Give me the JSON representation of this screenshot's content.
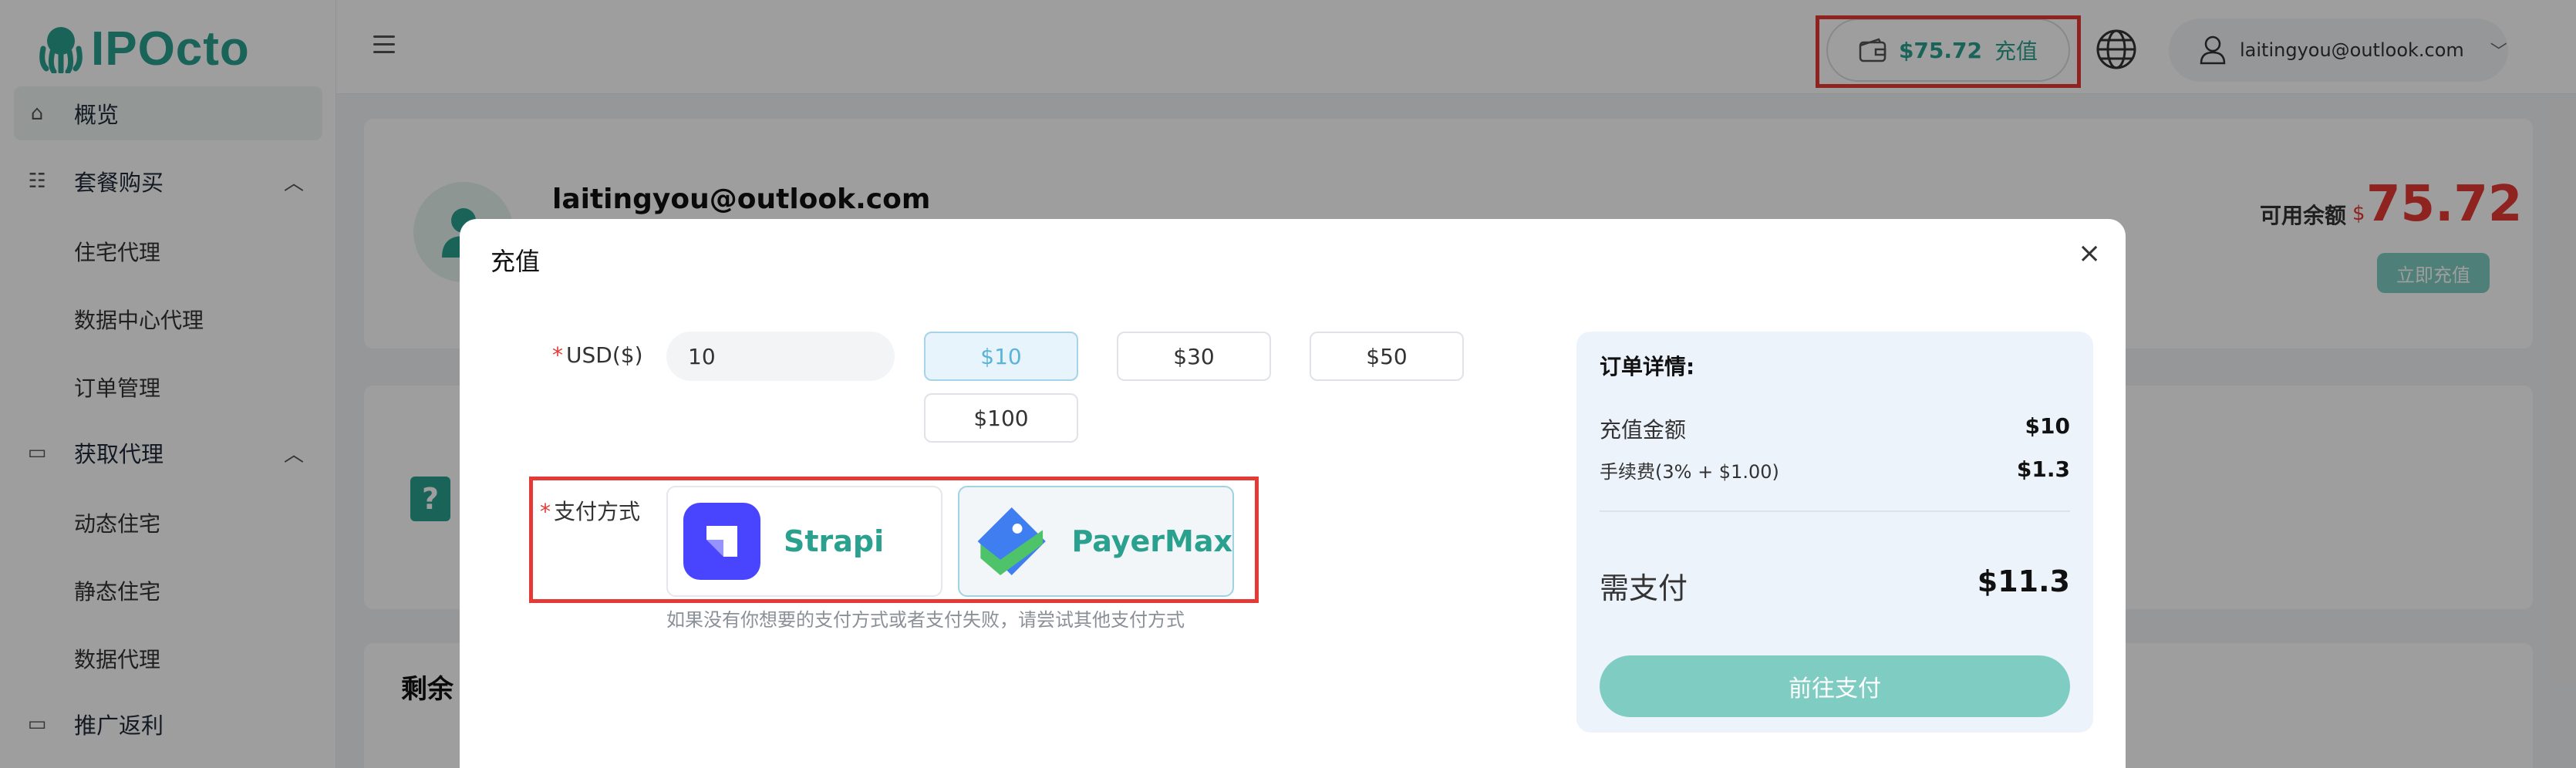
{
  "brand": {
    "name": "IPOcto",
    "accent": "#2aa18e"
  },
  "sidebar": {
    "items": [
      {
        "label": "概览",
        "icon": "home-icon"
      },
      {
        "label": "套餐购买",
        "icon": "package-icon",
        "expanded": true,
        "children": [
          "住宅代理",
          "数据中心代理",
          "订单管理"
        ]
      },
      {
        "label": "获取代理",
        "icon": "monitor-icon",
        "expanded": true,
        "children": [
          "动态住宅",
          "静态住宅",
          "数据代理"
        ]
      },
      {
        "label": "推广返利",
        "icon": "monitor-icon"
      }
    ]
  },
  "header": {
    "balance": "$75.72",
    "recharge_label": "充值",
    "user_email": "laitingyou@outlook.com"
  },
  "account_card": {
    "email": "laitingyou@outlook.com",
    "available_label": "可用余额",
    "currency": "$",
    "available_amount": "75.72",
    "recharge_now": "立即充值"
  },
  "remaining_section": {
    "title": "剩余"
  },
  "modal": {
    "title": "充值",
    "usd_label": "USD($)",
    "usd_value": "10",
    "amount_options": [
      "$10",
      "$30",
      "$50",
      "$100"
    ],
    "selected_amount": "$10",
    "payment_label": "支付方式",
    "payment_methods": [
      "Strapi",
      "PayerMax"
    ],
    "selected_method": "PayerMax",
    "payment_hint": "如果没有你想要的支付方式或者支付失败，请尝试其他支付方式"
  },
  "order": {
    "title": "订单详情:",
    "recharge_amount_label": "充值金额",
    "recharge_amount": "$10",
    "fee_label": "手续费(3% + $1.00)",
    "fee": "$1.3",
    "total_label": "需支付",
    "total": "$11.3",
    "pay_button": "前往支付"
  }
}
